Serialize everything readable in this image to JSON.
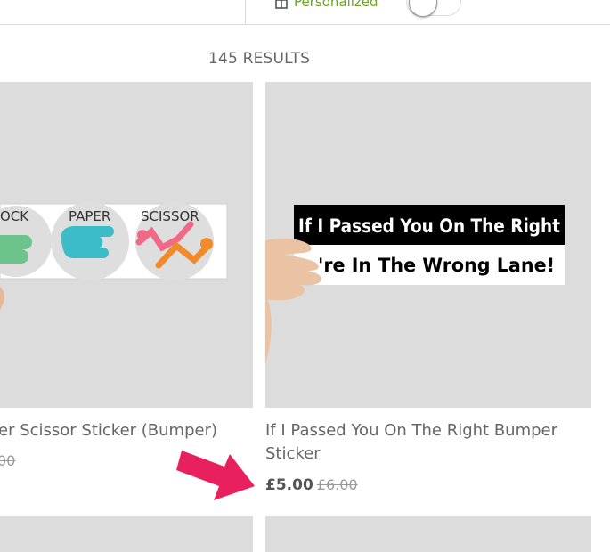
{
  "header": {
    "personalized_label": "Personalized",
    "personalized_icon": "gift-icon",
    "toggle_state": "off"
  },
  "results": {
    "count_label": "145 RESULTS"
  },
  "products": [
    {
      "title": "er Scissor Sticker (Bumper)",
      "old_price": "00",
      "image": {
        "labels": [
          "OCK",
          "PAPER",
          "SCISSOR"
        ]
      }
    },
    {
      "title_line1": "If I Passed You On The Right Bumper",
      "title_line2": "Sticker",
      "price": "£5.00",
      "old_price": "£6.00",
      "image": {
        "line1": "If I Passed You On The Right",
        "line2": "'re In The Wrong Lane!"
      }
    }
  ],
  "colors": {
    "accent_green": "#6aa51e",
    "arrow_pink": "#e8215e",
    "tile_gray": "#dcdcdd"
  }
}
